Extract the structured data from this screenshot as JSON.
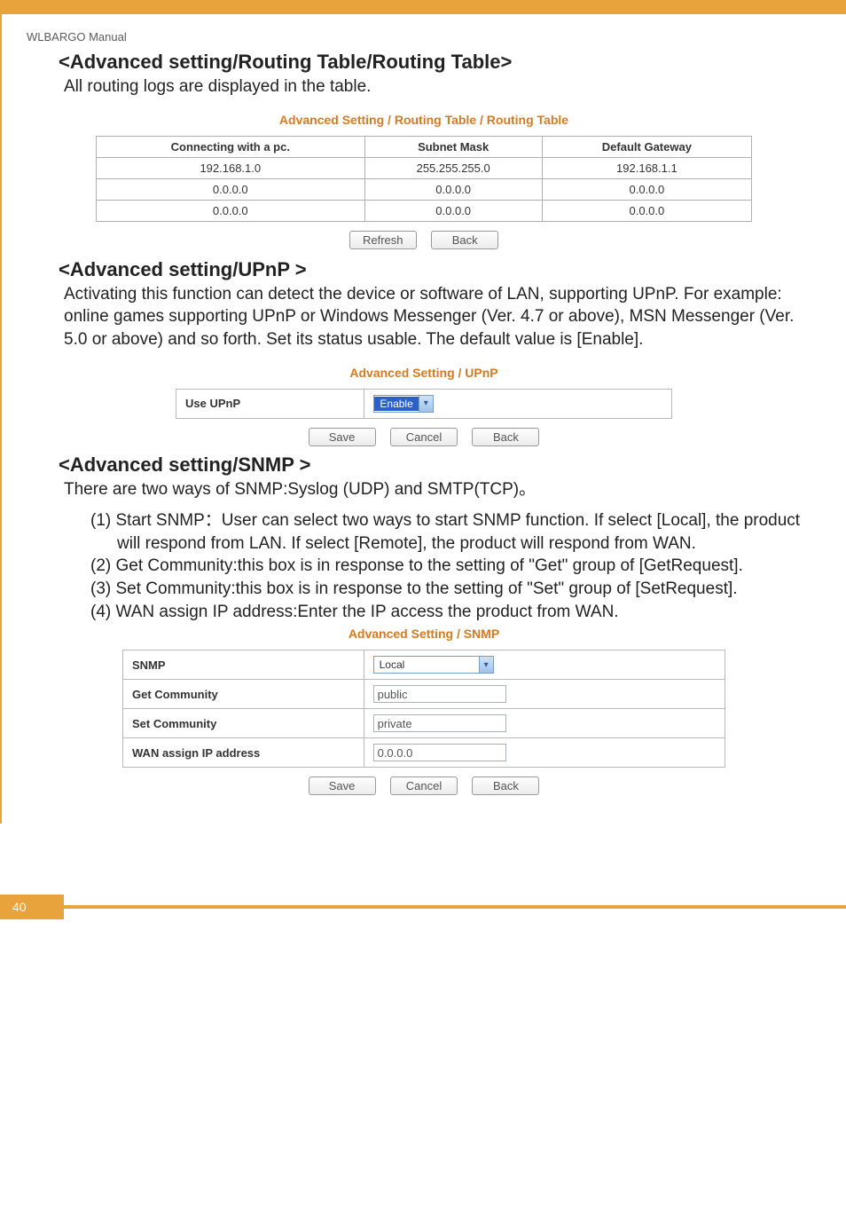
{
  "manual_label": "WLBARGO Manual",
  "routing": {
    "heading": "<Advanced setting/Routing Table/Routing Table>",
    "desc": "All routing logs are displayed in the table.",
    "crumb": "Advanced Setting / Routing Table / Routing Table",
    "headers": [
      "Connecting with a pc.",
      "Subnet Mask",
      "Default Gateway"
    ],
    "rows": [
      [
        "192.168.1.0",
        "255.255.255.0",
        "192.168.1.1"
      ],
      [
        "0.0.0.0",
        "0.0.0.0",
        "0.0.0.0"
      ],
      [
        "0.0.0.0",
        "0.0.0.0",
        "0.0.0.0"
      ]
    ],
    "buttons": {
      "refresh": "Refresh",
      "back": "Back"
    }
  },
  "upnp": {
    "heading": "<Advanced setting/UPnP >",
    "desc": "Activating this function can detect the device or software of LAN, supporting UPnP.  For example: online games supporting UPnP or Windows Messenger (Ver. 4.7 or above), MSN Messenger (Ver. 5.0 or above) and so forth.  Set its status usable.  The default value is [Enable].",
    "crumb": "Advanced Setting / UPnP",
    "label": "Use UPnP",
    "value": "Enable",
    "buttons": {
      "save": "Save",
      "cancel": "Cancel",
      "back": "Back"
    }
  },
  "snmp": {
    "heading": "<Advanced setting/SNMP >",
    "desc": "There are two ways of SNMP:Syslog (UDP) and SMTP(TCP)。",
    "items": [
      "(1) Start SNMP：User can select two ways to start SNMP function. If select [Local], the product will respond from LAN. If select [Remote], the product will respond from WAN.",
      "(2) Get Community:this box is in response to the setting of \"Get\" group of [GetRequest].",
      "(3) Set Community:this box is in response to the setting of \"Set\" group of [SetRequest].",
      "(4) WAN assign IP address:Enter the IP access the product from WAN."
    ],
    "crumb": "Advanced Setting / SNMP",
    "rows": [
      {
        "label": "SNMP",
        "type": "select",
        "value": "Local"
      },
      {
        "label": "Get Community",
        "type": "text",
        "value": "public"
      },
      {
        "label": "Set Community",
        "type": "text",
        "value": "private"
      },
      {
        "label": "WAN assign IP address",
        "type": "text",
        "value": "0.0.0.0"
      }
    ],
    "buttons": {
      "save": "Save",
      "cancel": "Cancel",
      "back": "Back"
    }
  },
  "page_number": "40"
}
